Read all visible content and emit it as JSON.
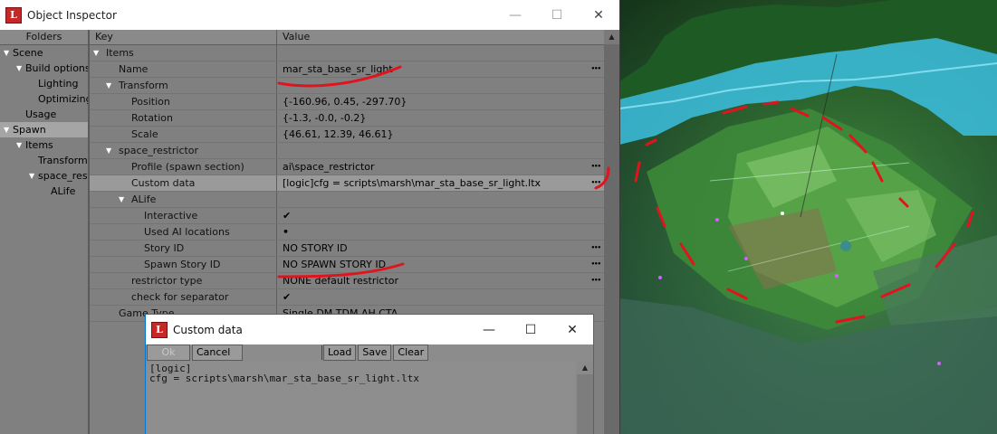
{
  "inspector": {
    "title": "Object Inspector",
    "folders_header": "Folders",
    "folders": [
      {
        "label": "Scene",
        "indent": 0,
        "arrow": true,
        "selected": false
      },
      {
        "label": "Build options",
        "indent": 1,
        "arrow": true,
        "selected": false
      },
      {
        "label": "Lighting",
        "indent": 2,
        "arrow": false,
        "selected": false
      },
      {
        "label": "Optimizing",
        "indent": 2,
        "arrow": false,
        "selected": false
      },
      {
        "label": "Usage",
        "indent": 1,
        "arrow": false,
        "selected": false
      },
      {
        "label": "Spawn",
        "indent": 0,
        "arrow": true,
        "selected": true
      },
      {
        "label": "Items",
        "indent": 1,
        "arrow": true,
        "selected": false
      },
      {
        "label": "Transform",
        "indent": 2,
        "arrow": false,
        "selected": false
      },
      {
        "label": "space_restr",
        "indent": 2,
        "arrow": true,
        "selected": false
      },
      {
        "label": "ALife",
        "indent": 3,
        "arrow": false,
        "selected": false
      }
    ],
    "key_header": "Key",
    "value_header": "Value",
    "properties": [
      {
        "key": "Items",
        "value": "",
        "indent": 0,
        "arrow": true,
        "dots": false,
        "check": false,
        "bullet": false,
        "highlight": false
      },
      {
        "key": "Name",
        "value": "mar_sta_base_sr_light",
        "indent": 1,
        "arrow": false,
        "dots": true,
        "check": false,
        "bullet": false,
        "highlight": false
      },
      {
        "key": "Transform",
        "value": "",
        "indent": 1,
        "arrow": true,
        "dots": false,
        "check": false,
        "bullet": false,
        "highlight": false
      },
      {
        "key": "Position",
        "value": "{-160.96, 0.45, -297.70}",
        "indent": 2,
        "arrow": false,
        "dots": false,
        "check": false,
        "bullet": false,
        "highlight": false
      },
      {
        "key": "Rotation",
        "value": "{-1.3, -0.0, -0.2}",
        "indent": 2,
        "arrow": false,
        "dots": false,
        "check": false,
        "bullet": false,
        "highlight": false
      },
      {
        "key": "Scale",
        "value": "{46.61, 12.39, 46.61}",
        "indent": 2,
        "arrow": false,
        "dots": false,
        "check": false,
        "bullet": false,
        "highlight": false
      },
      {
        "key": "space_restrictor",
        "value": "",
        "indent": 1,
        "arrow": true,
        "dots": false,
        "check": false,
        "bullet": false,
        "highlight": false
      },
      {
        "key": "Profile (spawn section)",
        "value": "ai\\space_restrictor",
        "indent": 2,
        "arrow": false,
        "dots": true,
        "check": false,
        "bullet": false,
        "highlight": false
      },
      {
        "key": "Custom data",
        "value": "[logic]cfg = scripts\\marsh\\mar_sta_base_sr_light.ltx",
        "indent": 2,
        "arrow": false,
        "dots": true,
        "check": false,
        "bullet": false,
        "highlight": true
      },
      {
        "key": "ALife",
        "value": "",
        "indent": 2,
        "arrow": true,
        "dots": false,
        "check": false,
        "bullet": false,
        "highlight": false
      },
      {
        "key": "Interactive",
        "value": "",
        "indent": 3,
        "arrow": false,
        "dots": false,
        "check": true,
        "bullet": false,
        "highlight": false
      },
      {
        "key": "Used AI locations",
        "value": "",
        "indent": 3,
        "arrow": false,
        "dots": false,
        "check": false,
        "bullet": true,
        "highlight": false
      },
      {
        "key": "Story ID",
        "value": "NO STORY ID",
        "indent": 3,
        "arrow": false,
        "dots": true,
        "check": false,
        "bullet": false,
        "highlight": false
      },
      {
        "key": "Spawn Story ID",
        "value": "NO SPAWN STORY ID",
        "indent": 3,
        "arrow": false,
        "dots": true,
        "check": false,
        "bullet": false,
        "highlight": false
      },
      {
        "key": "restrictor type",
        "value": "NONE default restrictor",
        "indent": 2,
        "arrow": false,
        "dots": true,
        "check": false,
        "bullet": false,
        "highlight": false
      },
      {
        "key": "check for separator",
        "value": "",
        "indent": 2,
        "arrow": false,
        "dots": false,
        "check": true,
        "bullet": false,
        "highlight": false
      },
      {
        "key": "Game Type",
        "value": "Single DM TDM AH CTA",
        "indent": 1,
        "arrow": false,
        "dots": false,
        "check": false,
        "bullet": false,
        "highlight": false
      }
    ]
  },
  "dialog": {
    "title": "Custom data",
    "buttons": {
      "ok": "Ok",
      "cancel": "Cancel",
      "load": "Load",
      "save": "Save",
      "clear": "Clear"
    },
    "text": "[logic]\ncfg = scripts\\marsh\\mar_sta_base_sr_light.ltx"
  },
  "window_controls": {
    "minimize": "—",
    "maximize": "☐",
    "close": "✕"
  },
  "app_icon_letter": "L",
  "colors": {
    "annotation_red": "#e0141e",
    "accent_blue": "#0078d7"
  }
}
